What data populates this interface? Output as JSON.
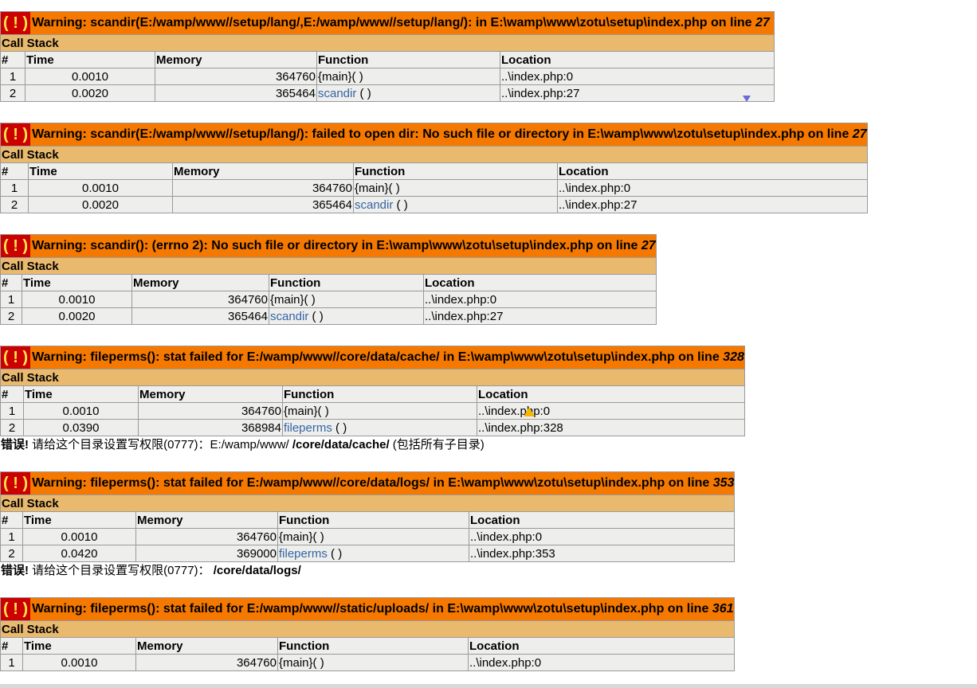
{
  "call_stack_label": "Call Stack",
  "bang": "( ! )",
  "headers": {
    "num": "#",
    "time": "Time",
    "memory": "Memory",
    "function": "Function",
    "location": "Location"
  },
  "errors": [
    {
      "message": "Warning: scandir(E:/wamp/www//setup/lang/,E:/wamp/www//setup/lang/): in E:\\wamp\\www\\zotu\\setup\\index.php on line ",
      "line": "27",
      "rows": [
        {
          "num": "1",
          "time": "0.0010",
          "memory": "364760",
          "func": "{main}( )",
          "loc": "..\\index.php:0"
        },
        {
          "num": "2",
          "time": "0.0020",
          "memory": "365464",
          "func_name": "scandir",
          "func_suffix": " ( )",
          "loc": "..\\index.php:27"
        }
      ]
    },
    {
      "message": "Warning: scandir(E:/wamp/www//setup/lang/): failed to open dir: No such file or directory in E:\\wamp\\www\\zotu\\setup\\index.php on line ",
      "line": "27",
      "rows": [
        {
          "num": "1",
          "time": "0.0010",
          "memory": "364760",
          "func": "{main}( )",
          "loc": "..\\index.php:0"
        },
        {
          "num": "2",
          "time": "0.0020",
          "memory": "365464",
          "func_name": "scandir",
          "func_suffix": " ( )",
          "loc": "..\\index.php:27"
        }
      ]
    },
    {
      "message": "Warning: scandir(): (errno 2): No such file or directory in E:\\wamp\\www\\zotu\\setup\\index.php on line ",
      "line": "27",
      "rows": [
        {
          "num": "1",
          "time": "0.0010",
          "memory": "364760",
          "func": "{main}( )",
          "loc": "..\\index.php:0"
        },
        {
          "num": "2",
          "time": "0.0020",
          "memory": "365464",
          "func_name": "scandir",
          "func_suffix": " ( )",
          "loc": "..\\index.php:27"
        }
      ]
    },
    {
      "message": "Warning: fileperms(): stat failed for E:/wamp/www//core/data/cache/ in E:\\wamp\\www\\zotu\\setup\\index.php on line ",
      "line": "328",
      "rows": [
        {
          "num": "1",
          "time": "0.0010",
          "memory": "364760",
          "func": "{main}( )",
          "loc": "..\\index.php:0"
        },
        {
          "num": "2",
          "time": "0.0390",
          "memory": "368984",
          "func_name": "fileperms",
          "func_suffix": " ( )",
          "loc": "..\\index.php:328"
        }
      ]
    },
    {
      "message": "Warning: fileperms(): stat failed for E:/wamp/www//core/data/logs/ in E:\\wamp\\www\\zotu\\setup\\index.php on line ",
      "line": "353",
      "rows": [
        {
          "num": "1",
          "time": "0.0010",
          "memory": "364760",
          "func": "{main}( )",
          "loc": "..\\index.php:0"
        },
        {
          "num": "2",
          "time": "0.0420",
          "memory": "369000",
          "func_name": "fileperms",
          "func_suffix": " ( )",
          "loc": "..\\index.php:353"
        }
      ]
    },
    {
      "message": "Warning: fileperms(): stat failed for E:/wamp/www//static/uploads/ in E:\\wamp\\www\\zotu\\setup\\index.php on line ",
      "line": "361",
      "rows": [
        {
          "num": "1",
          "time": "0.0010",
          "memory": "364760",
          "func": "{main}( )",
          "loc": "..\\index.php:0"
        }
      ]
    }
  ],
  "notices": [
    {
      "label": "错误!",
      "text": " 请给这个目录设置写权限(0777)：E:/wamp/www/ ",
      "path": "/core/data/cache/",
      "suffix": " (包括所有子目录)"
    },
    {
      "label": "错误!",
      "text": " 请给这个目录设置写权限(0777)：  ",
      "path": "/core/data/logs/",
      "suffix": ""
    }
  ],
  "colors": {
    "error_header": "#f57900",
    "bang_bg": "#cc0000",
    "bang_fg": "#fce94f",
    "callstack": "#e9b96e",
    "row": "#eeeeec",
    "link": "#3465a4"
  }
}
